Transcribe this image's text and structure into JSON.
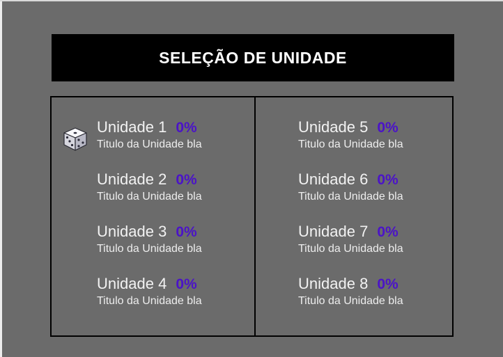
{
  "title": "SELEÇÃO DE UNIDADE",
  "colors": {
    "background": "#6b6b6b",
    "title_bar": "#000000",
    "percent": "#4b13c8",
    "text": "#f2f2f2"
  },
  "selector_icon": "dice-icon",
  "units": [
    {
      "name": "Unidade 1",
      "percent": "0%",
      "subtitle": "Titulo da Unidade bla",
      "selected": true
    },
    {
      "name": "Unidade 2",
      "percent": "0%",
      "subtitle": "Titulo da Unidade bla",
      "selected": false
    },
    {
      "name": "Unidade 3",
      "percent": "0%",
      "subtitle": "Titulo da Unidade bla",
      "selected": false
    },
    {
      "name": "Unidade 4",
      "percent": "0%",
      "subtitle": "Titulo da Unidade bla",
      "selected": false
    },
    {
      "name": "Unidade 5",
      "percent": "0%",
      "subtitle": "Titulo da Unidade bla",
      "selected": false
    },
    {
      "name": "Unidade 6",
      "percent": "0%",
      "subtitle": "Titulo da Unidade bla",
      "selected": false
    },
    {
      "name": "Unidade 7",
      "percent": "0%",
      "subtitle": "Titulo da Unidade bla",
      "selected": false
    },
    {
      "name": "Unidade 8",
      "percent": "0%",
      "subtitle": "Titulo da Unidade bla",
      "selected": false
    }
  ]
}
